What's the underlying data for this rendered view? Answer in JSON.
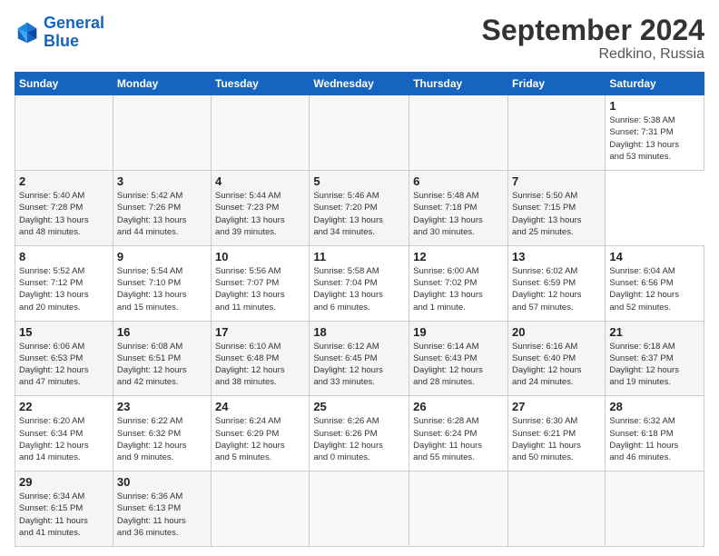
{
  "header": {
    "logo_line1": "General",
    "logo_line2": "Blue",
    "title": "September 2024",
    "subtitle": "Redkino, Russia"
  },
  "calendar": {
    "headers": [
      "Sunday",
      "Monday",
      "Tuesday",
      "Wednesday",
      "Thursday",
      "Friday",
      "Saturday"
    ],
    "weeks": [
      [
        {
          "day": "",
          "info": ""
        },
        {
          "day": "",
          "info": ""
        },
        {
          "day": "",
          "info": ""
        },
        {
          "day": "",
          "info": ""
        },
        {
          "day": "",
          "info": ""
        },
        {
          "day": "",
          "info": ""
        },
        {
          "day": "1",
          "info": "Sunrise: 5:38 AM\nSunset: 7:31 PM\nDaylight: 13 hours\nand 53 minutes."
        }
      ],
      [
        {
          "day": "2",
          "info": "Sunrise: 5:40 AM\nSunset: 7:28 PM\nDaylight: 13 hours\nand 48 minutes."
        },
        {
          "day": "3",
          "info": "Sunrise: 5:42 AM\nSunset: 7:26 PM\nDaylight: 13 hours\nand 44 minutes."
        },
        {
          "day": "4",
          "info": "Sunrise: 5:44 AM\nSunset: 7:23 PM\nDaylight: 13 hours\nand 39 minutes."
        },
        {
          "day": "5",
          "info": "Sunrise: 5:46 AM\nSunset: 7:20 PM\nDaylight: 13 hours\nand 34 minutes."
        },
        {
          "day": "6",
          "info": "Sunrise: 5:48 AM\nSunset: 7:18 PM\nDaylight: 13 hours\nand 30 minutes."
        },
        {
          "day": "7",
          "info": "Sunrise: 5:50 AM\nSunset: 7:15 PM\nDaylight: 13 hours\nand 25 minutes."
        }
      ],
      [
        {
          "day": "8",
          "info": "Sunrise: 5:52 AM\nSunset: 7:12 PM\nDaylight: 13 hours\nand 20 minutes."
        },
        {
          "day": "9",
          "info": "Sunrise: 5:54 AM\nSunset: 7:10 PM\nDaylight: 13 hours\nand 15 minutes."
        },
        {
          "day": "10",
          "info": "Sunrise: 5:56 AM\nSunset: 7:07 PM\nDaylight: 13 hours\nand 11 minutes."
        },
        {
          "day": "11",
          "info": "Sunrise: 5:58 AM\nSunset: 7:04 PM\nDaylight: 13 hours\nand 6 minutes."
        },
        {
          "day": "12",
          "info": "Sunrise: 6:00 AM\nSunset: 7:02 PM\nDaylight: 13 hours\nand 1 minute."
        },
        {
          "day": "13",
          "info": "Sunrise: 6:02 AM\nSunset: 6:59 PM\nDaylight: 12 hours\nand 57 minutes."
        },
        {
          "day": "14",
          "info": "Sunrise: 6:04 AM\nSunset: 6:56 PM\nDaylight: 12 hours\nand 52 minutes."
        }
      ],
      [
        {
          "day": "15",
          "info": "Sunrise: 6:06 AM\nSunset: 6:53 PM\nDaylight: 12 hours\nand 47 minutes."
        },
        {
          "day": "16",
          "info": "Sunrise: 6:08 AM\nSunset: 6:51 PM\nDaylight: 12 hours\nand 42 minutes."
        },
        {
          "day": "17",
          "info": "Sunrise: 6:10 AM\nSunset: 6:48 PM\nDaylight: 12 hours\nand 38 minutes."
        },
        {
          "day": "18",
          "info": "Sunrise: 6:12 AM\nSunset: 6:45 PM\nDaylight: 12 hours\nand 33 minutes."
        },
        {
          "day": "19",
          "info": "Sunrise: 6:14 AM\nSunset: 6:43 PM\nDaylight: 12 hours\nand 28 minutes."
        },
        {
          "day": "20",
          "info": "Sunrise: 6:16 AM\nSunset: 6:40 PM\nDaylight: 12 hours\nand 24 minutes."
        },
        {
          "day": "21",
          "info": "Sunrise: 6:18 AM\nSunset: 6:37 PM\nDaylight: 12 hours\nand 19 minutes."
        }
      ],
      [
        {
          "day": "22",
          "info": "Sunrise: 6:20 AM\nSunset: 6:34 PM\nDaylight: 12 hours\nand 14 minutes."
        },
        {
          "day": "23",
          "info": "Sunrise: 6:22 AM\nSunset: 6:32 PM\nDaylight: 12 hours\nand 9 minutes."
        },
        {
          "day": "24",
          "info": "Sunrise: 6:24 AM\nSunset: 6:29 PM\nDaylight: 12 hours\nand 5 minutes."
        },
        {
          "day": "25",
          "info": "Sunrise: 6:26 AM\nSunset: 6:26 PM\nDaylight: 12 hours\nand 0 minutes."
        },
        {
          "day": "26",
          "info": "Sunrise: 6:28 AM\nSunset: 6:24 PM\nDaylight: 11 hours\nand 55 minutes."
        },
        {
          "day": "27",
          "info": "Sunrise: 6:30 AM\nSunset: 6:21 PM\nDaylight: 11 hours\nand 50 minutes."
        },
        {
          "day": "28",
          "info": "Sunrise: 6:32 AM\nSunset: 6:18 PM\nDaylight: 11 hours\nand 46 minutes."
        }
      ],
      [
        {
          "day": "29",
          "info": "Sunrise: 6:34 AM\nSunset: 6:15 PM\nDaylight: 11 hours\nand 41 minutes."
        },
        {
          "day": "30",
          "info": "Sunrise: 6:36 AM\nSunset: 6:13 PM\nDaylight: 11 hours\nand 36 minutes."
        },
        {
          "day": "",
          "info": ""
        },
        {
          "day": "",
          "info": ""
        },
        {
          "day": "",
          "info": ""
        },
        {
          "day": "",
          "info": ""
        },
        {
          "day": "",
          "info": ""
        }
      ]
    ]
  }
}
